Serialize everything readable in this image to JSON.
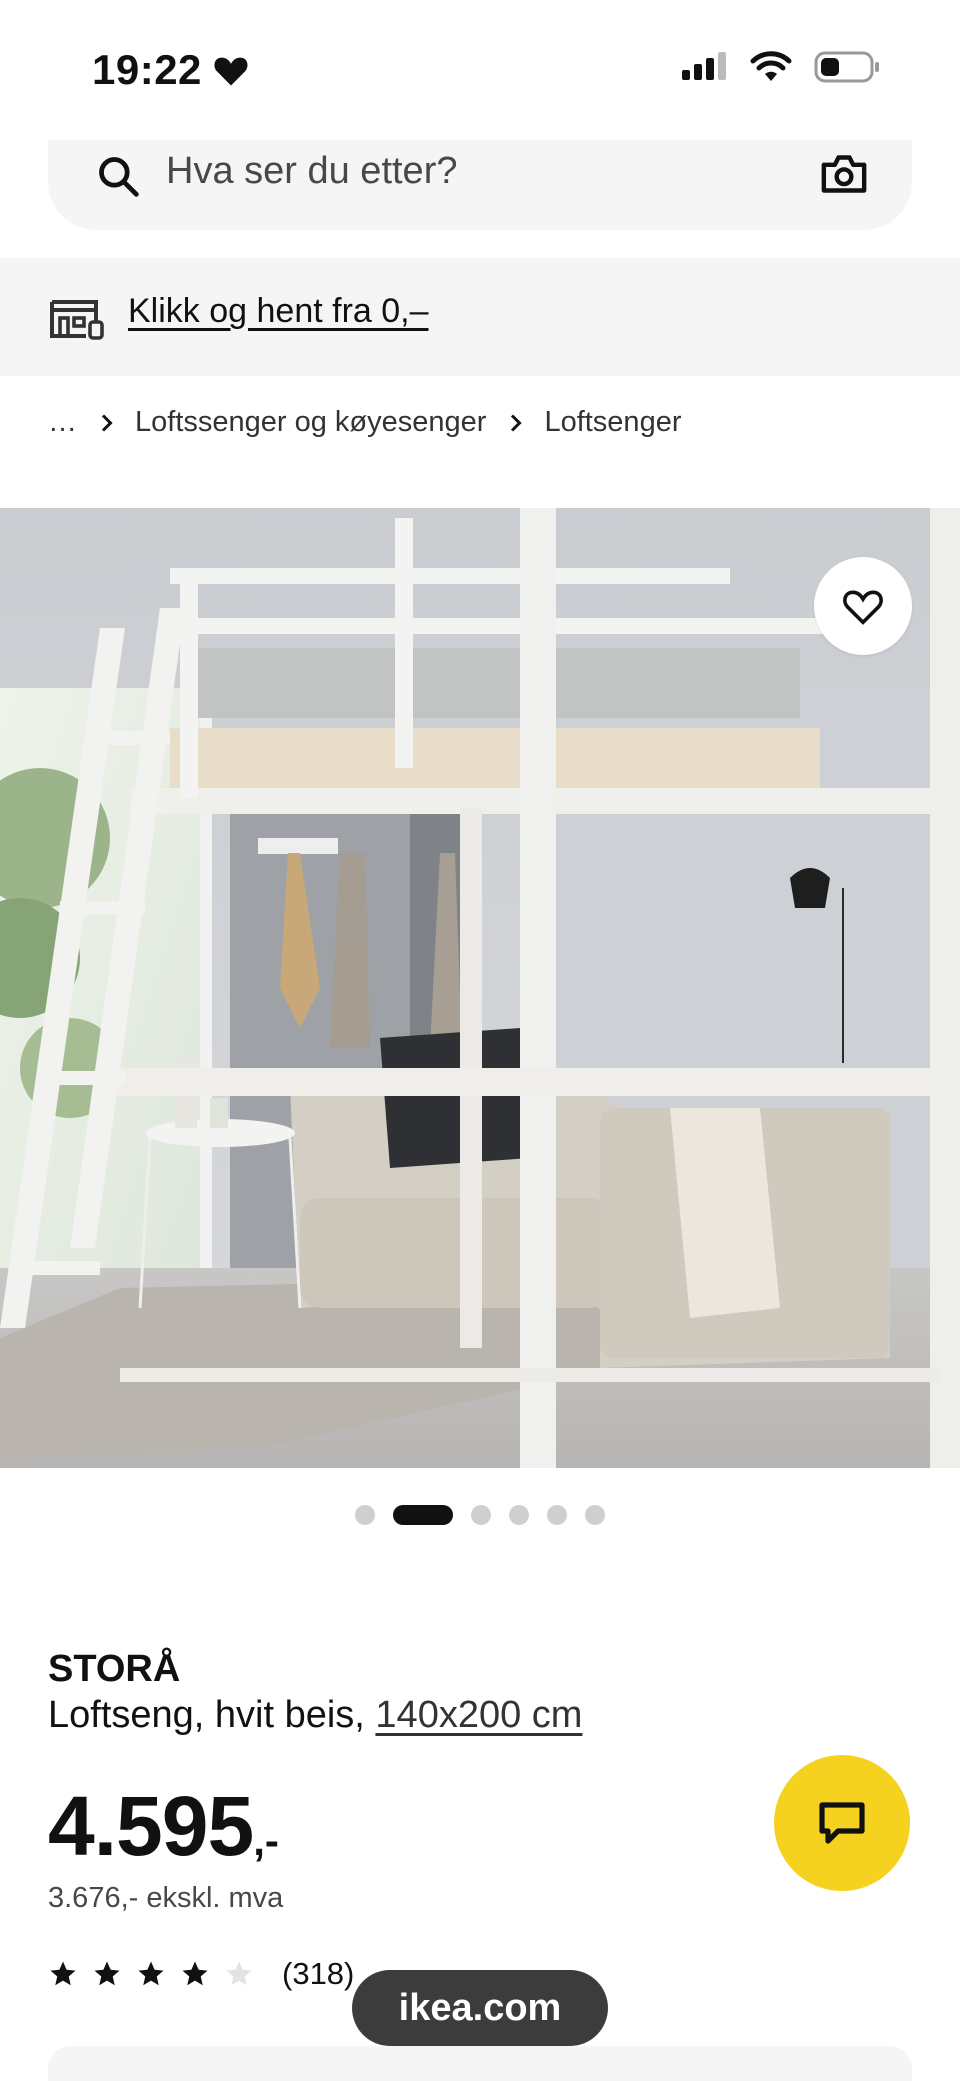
{
  "status_bar": {
    "time": "19:22",
    "icons": [
      "heart-icon",
      "cellular-signal-icon",
      "wifi-icon",
      "battery-icon"
    ]
  },
  "search": {
    "placeholder": "Hva ser du etter?"
  },
  "pickup": {
    "label": "Klikk og hent fra 0,–"
  },
  "breadcrumb": {
    "ellipsis": "…",
    "items": [
      "Loftssenger og køyesenger",
      "Loftsenger"
    ]
  },
  "gallery": {
    "image_count": 6,
    "active_index": 1
  },
  "product": {
    "brand": "STORÅ",
    "description": "Loftseng, hvit beis, ",
    "size": "140x200 cm",
    "price": "4.595",
    "price_suffix": ",-",
    "price_ex_vat": "3.676,- ekskl. mva",
    "rating": 4,
    "rating_max": 5,
    "review_count": "(318)"
  },
  "browser": {
    "url": "ikea.com"
  },
  "colors": {
    "chat_button": "#f5d21f",
    "pickup_bg": "#f5f5f5",
    "text": "#111111"
  }
}
